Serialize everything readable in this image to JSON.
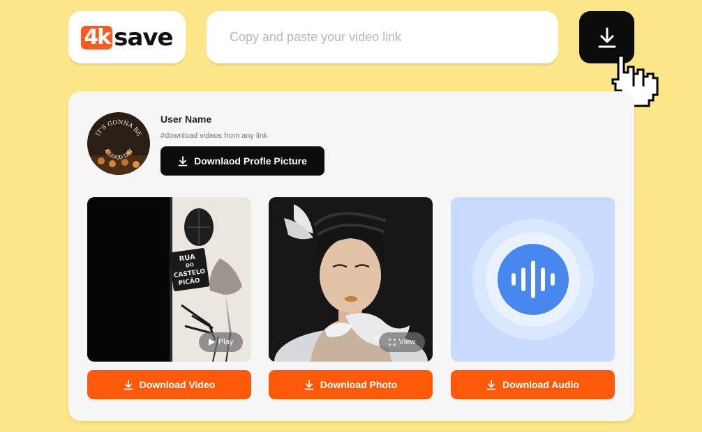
{
  "header": {
    "logo": {
      "number": "4k",
      "word": "save"
    },
    "search": {
      "placeholder": "Copy and paste your video link",
      "value": ""
    },
    "download_icon": "download-icon"
  },
  "profile": {
    "username": "User Name",
    "tagline": "#download videos from any link",
    "download_profile_label": "Downlaod Profle Picture",
    "avatar_text": "IT'S GONNA BE A GOOD DAY"
  },
  "media": {
    "video": {
      "play_label": "Play",
      "sign_text": [
        "RUA",
        "DO",
        "CASTELO",
        "PICÃO"
      ]
    },
    "photo": {
      "view_label": "View"
    },
    "audio": {
      "icon": "audio-wave-icon"
    }
  },
  "actions": {
    "download_video_label": "Download Video",
    "download_photo_label": "Download Photo",
    "download_audio_label": "Download Audio"
  },
  "colors": {
    "background": "#fde58a",
    "accent": "#ff5a0a",
    "dark": "#0c0c0c",
    "audio_blue": "#4787ee"
  }
}
